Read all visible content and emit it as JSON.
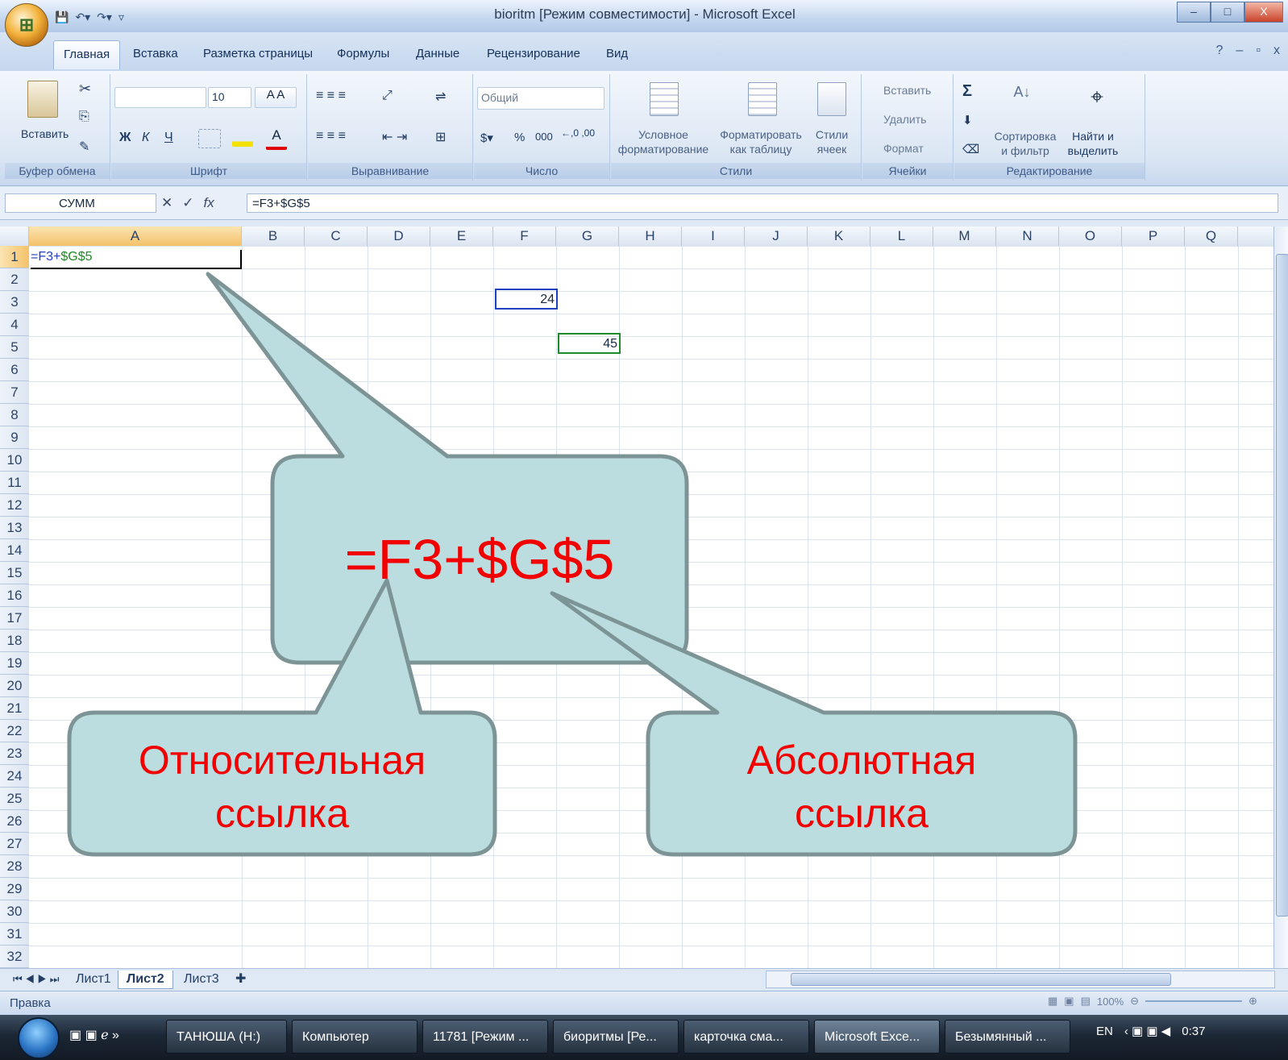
{
  "window": {
    "title": "bioritm  [Режим совместимости] - Microsoft Excel",
    "controls": [
      "–",
      "□",
      "X"
    ]
  },
  "ribbon": {
    "tabs": [
      "Главная",
      "Вставка",
      "Разметка страницы",
      "Формулы",
      "Данные",
      "Рецензирование",
      "Вид"
    ],
    "active_tab": "Главная",
    "clipboard": {
      "paste": "Вставить",
      "label": "Буфер обмена"
    },
    "font": {
      "size": "10",
      "bold": "Ж",
      "italic": "К",
      "underline": "Ч",
      "label": "Шрифт"
    },
    "alignment": {
      "label": "Выравнивание"
    },
    "number": {
      "format": "Общий",
      "percent": "%",
      "thousands": "000",
      "label": "Число"
    },
    "styles": {
      "conditional": "Условное форматирование",
      "as_table": "Форматировать как таблицу",
      "cell_styles": "Стили ячеек",
      "label": "Стили"
    },
    "cells": {
      "insert": "Вставить",
      "delete": "Удалить",
      "format": "Формат",
      "label": "Ячейки"
    },
    "editing": {
      "sort": "Сортировка и фильтр",
      "find": "Найти и выделить",
      "label": "Редактирование",
      "sigma": "Σ"
    }
  },
  "formula_bar": {
    "name_box": "СУММ",
    "formula": "=F3+$G$5"
  },
  "grid": {
    "columns": [
      "A",
      "B",
      "C",
      "D",
      "E",
      "F",
      "G",
      "H",
      "I",
      "J",
      "K",
      "L",
      "M",
      "N",
      "O",
      "P",
      "Q"
    ],
    "rows": [
      "1",
      "2",
      "3",
      "4",
      "5",
      "6",
      "7",
      "8",
      "9",
      "10",
      "11",
      "12",
      "13",
      "14",
      "15",
      "16",
      "17",
      "18",
      "19",
      "20",
      "21",
      "22",
      "23",
      "24",
      "25",
      "26",
      "27",
      "28",
      "29",
      "30",
      "31",
      "32"
    ],
    "cells": {
      "A1_prefix": "=F3+",
      "A1_abs": "$G$5",
      "F3": "24",
      "G5": "45"
    }
  },
  "sheets": [
    "Лист1",
    "Лист2",
    "Лист3"
  ],
  "active_sheet": "Лист2",
  "status": "Правка",
  "zoom_level": "100%",
  "taskbar": {
    "items": [
      "ТАНЮША (H:)",
      "Компьютер",
      "11781 [Режим ...",
      "биоритмы [Ре...",
      "карточка сма...",
      "Microsoft Exce...",
      "Безымянный ..."
    ],
    "lang": "EN",
    "clock": "0:37"
  },
  "callouts": {
    "main": "=F3+$G$5",
    "relative": [
      "Относительная",
      "ссылка"
    ],
    "absolute": [
      "Абсолютная",
      "ссылка"
    ]
  },
  "colors": {
    "callout_fill": "#bcdddf",
    "callout_stroke": "#7d9497",
    "callout_text": "#f20000",
    "ref_blue": "#1f3fbf",
    "ref_green": "#1f8a2a"
  }
}
